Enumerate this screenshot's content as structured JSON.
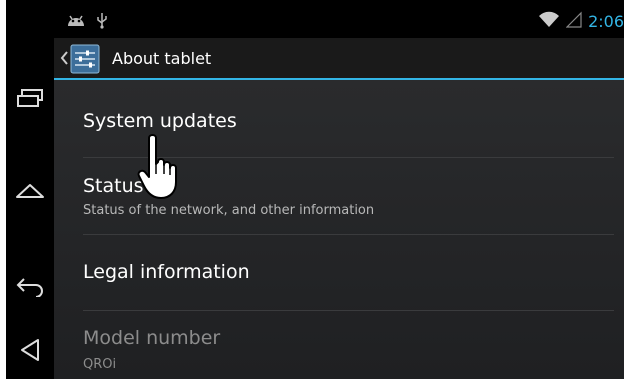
{
  "status_bar": {
    "time": "2:06",
    "icons": [
      "android-debug-icon",
      "usb-icon",
      "wifi-icon",
      "cell-signal-icon"
    ]
  },
  "action_bar": {
    "title": "About tablet",
    "icon": "settings-icon"
  },
  "nav_buttons": [
    "recent-apps-icon",
    "home-icon",
    "back-icon",
    "menu-triangle-icon"
  ],
  "list": [
    {
      "title": "System updates",
      "subtitle": ""
    },
    {
      "title": "Status",
      "subtitle": "Status of the network, and other information"
    },
    {
      "title": "Legal information",
      "subtitle": ""
    },
    {
      "title": "Model number",
      "subtitle": "QROi",
      "disabled": true
    }
  ],
  "colors": {
    "accent": "#33b5e5",
    "background": "#26272a"
  },
  "cursor": "hand-pointer-icon"
}
